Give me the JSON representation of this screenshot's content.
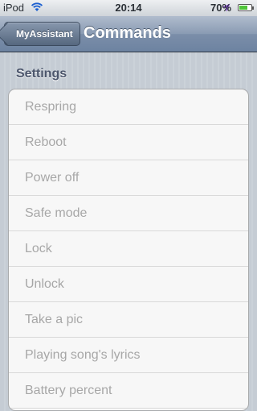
{
  "status_bar": {
    "carrier": "iPod",
    "time": "20:14",
    "battery_percent": "70%",
    "battery_level": 0.7,
    "icons": [
      "wifi-icon",
      "location-arrow-icon",
      "battery-icon"
    ]
  },
  "nav": {
    "back_label": "MyAssistant",
    "title": "Commands"
  },
  "section": {
    "header": "Settings"
  },
  "commands": [
    "Respring",
    "Reboot",
    "Power off",
    "Safe mode",
    "Lock",
    "Unlock",
    "Take a pic",
    "Playing song's lyrics",
    "Battery percent"
  ],
  "colors": {
    "location_arrow": "#8a4fd8",
    "battery_fill": "#4fc43a",
    "cell_text": "#a7a7a7"
  }
}
